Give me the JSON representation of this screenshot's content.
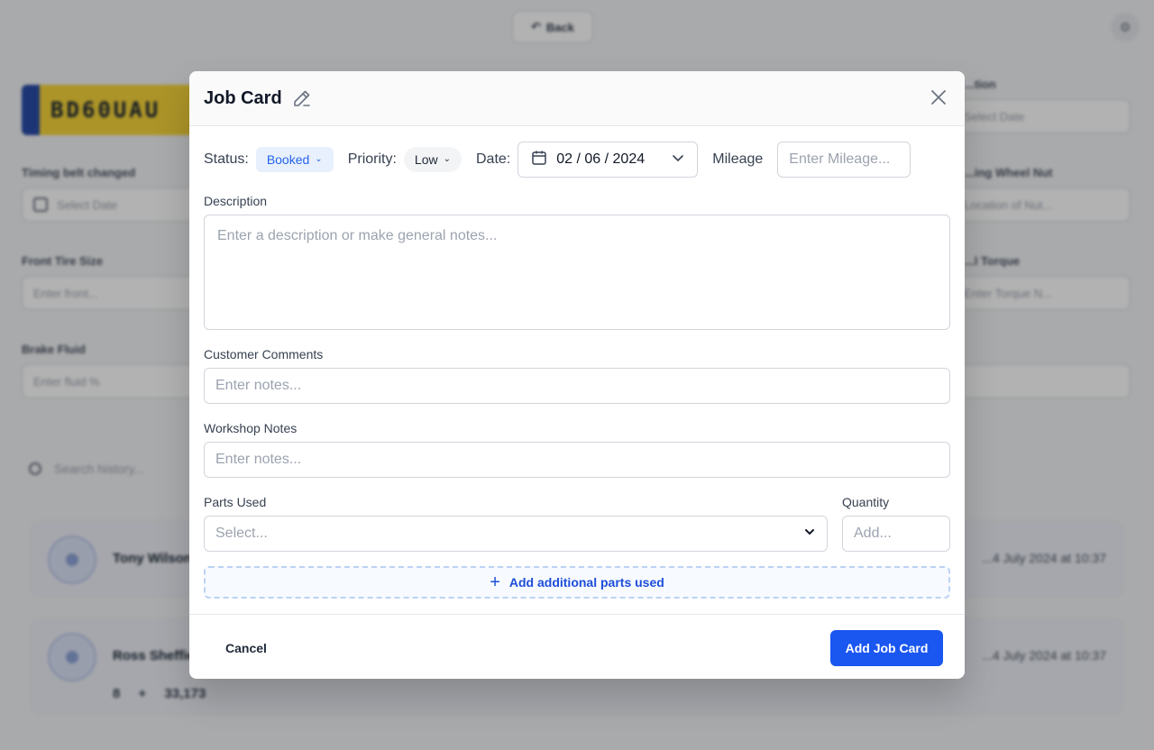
{
  "background": {
    "back_label": "Back",
    "plate_text": "BD60UAU",
    "labels": {
      "timing_belt": "Timing belt changed",
      "front_tire": "Front Tire Size",
      "brake_fluid": "Brake Fluid",
      "right_top": "...tion",
      "locking_wheel_nut": "...ing Wheel Nut",
      "wheel_torque": "...l Torque"
    },
    "placeholders": {
      "timing_belt": "Select Date",
      "front_tire": "Enter front...",
      "brake_fluid": "Enter fluid %",
      "right_top": "Select Date",
      "locking_wheel_nut": "Location of Nut...",
      "wheel_torque": "Enter Torque N..."
    },
    "search_placeholder": "Search history...",
    "cards": [
      {
        "name": "Tony Wilson",
        "date": "...4 July 2024 at 10:37"
      },
      {
        "name": "Ross Sheffield",
        "date": "...4 July 2024 at 10:37",
        "meta": "8  +  33,173"
      }
    ]
  },
  "modal": {
    "title": "Job Card",
    "status_label": "Status:",
    "status_value": "Booked",
    "priority_label": "Priority:",
    "priority_value": "Low",
    "date_label": "Date:",
    "date_value": "02 / 06 / 2024",
    "mileage_label": "Mileage",
    "mileage_placeholder": "Enter Mileage...",
    "description_label": "Description",
    "description_placeholder": "Enter a description or make general notes...",
    "customer_comments_label": "Customer Comments",
    "customer_comments_placeholder": "Enter notes...",
    "workshop_notes_label": "Workshop Notes",
    "workshop_notes_placeholder": "Enter notes...",
    "parts_used_label": "Parts Used",
    "parts_select_placeholder": "Select...",
    "quantity_label": "Quantity",
    "quantity_placeholder": "Add...",
    "add_parts_label": "Add additional parts used",
    "cancel_label": "Cancel",
    "submit_label": "Add Job Card"
  },
  "colors": {
    "primary": "#1a56f0",
    "status_bg": "#e8f0fd",
    "status_text": "#2563eb"
  },
  "icons": [
    "edit-pencil-icon",
    "close-icon",
    "calendar-icon",
    "chevron-down-icon",
    "plus-icon"
  ]
}
